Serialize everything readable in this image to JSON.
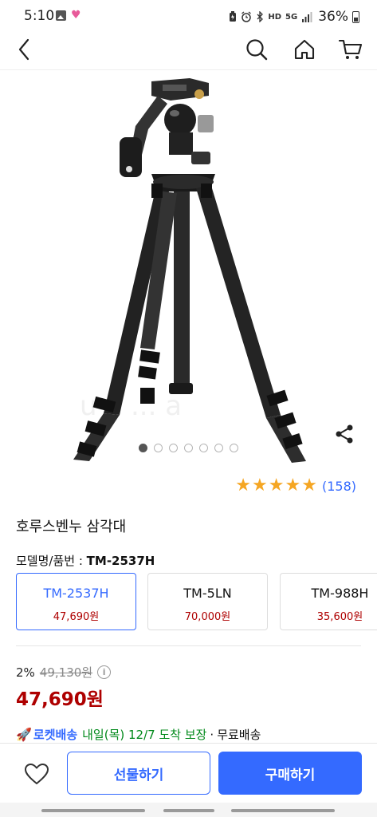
{
  "status_bar": {
    "time": "5:10",
    "battery_text": "36%",
    "icons": [
      "image-icon",
      "heart-icon",
      "battery-saver-icon",
      "alarm-icon",
      "bluetooth-icon",
      "hd-voice-icon",
      "5g-icon",
      "signal-icon",
      "battery-icon"
    ],
    "hd_label": "HD",
    "net_label": "5G"
  },
  "header": {
    "icons": [
      "back-arrow-icon",
      "search-icon",
      "home-icon",
      "cart-icon"
    ]
  },
  "gallery": {
    "dot_count": 7,
    "active_index": 0,
    "share_icon": "share-icon"
  },
  "rating": {
    "stars": 5,
    "count_text": "(158)"
  },
  "product": {
    "title": "호루스벤누 삼각대",
    "model_label": "모델명/품번 :",
    "model_value": "TM-2537H"
  },
  "options": [
    {
      "name": "TM-2537H",
      "price": "47,690원",
      "selected": true
    },
    {
      "name": "TM-5LN",
      "price": "70,000원",
      "selected": false
    },
    {
      "name": "TM-988H",
      "price": "35,600원",
      "selected": false
    }
  ],
  "pricing": {
    "discount": "2%",
    "original": "49,130원",
    "sale": "47,690원"
  },
  "delivery": {
    "rocket_label": "로켓배송",
    "date": "내일(목) 12/7 도착 보장",
    "separator": "·",
    "shipping": "무료배송"
  },
  "bottom_bar": {
    "wish_icon": "heart-outline-icon",
    "gift_label": "선물하기",
    "buy_label": "구매하기"
  },
  "colors": {
    "accent": "#346aff",
    "price_red": "#ae0000",
    "star": "#f5a623",
    "delivery_green": "#00891a"
  }
}
